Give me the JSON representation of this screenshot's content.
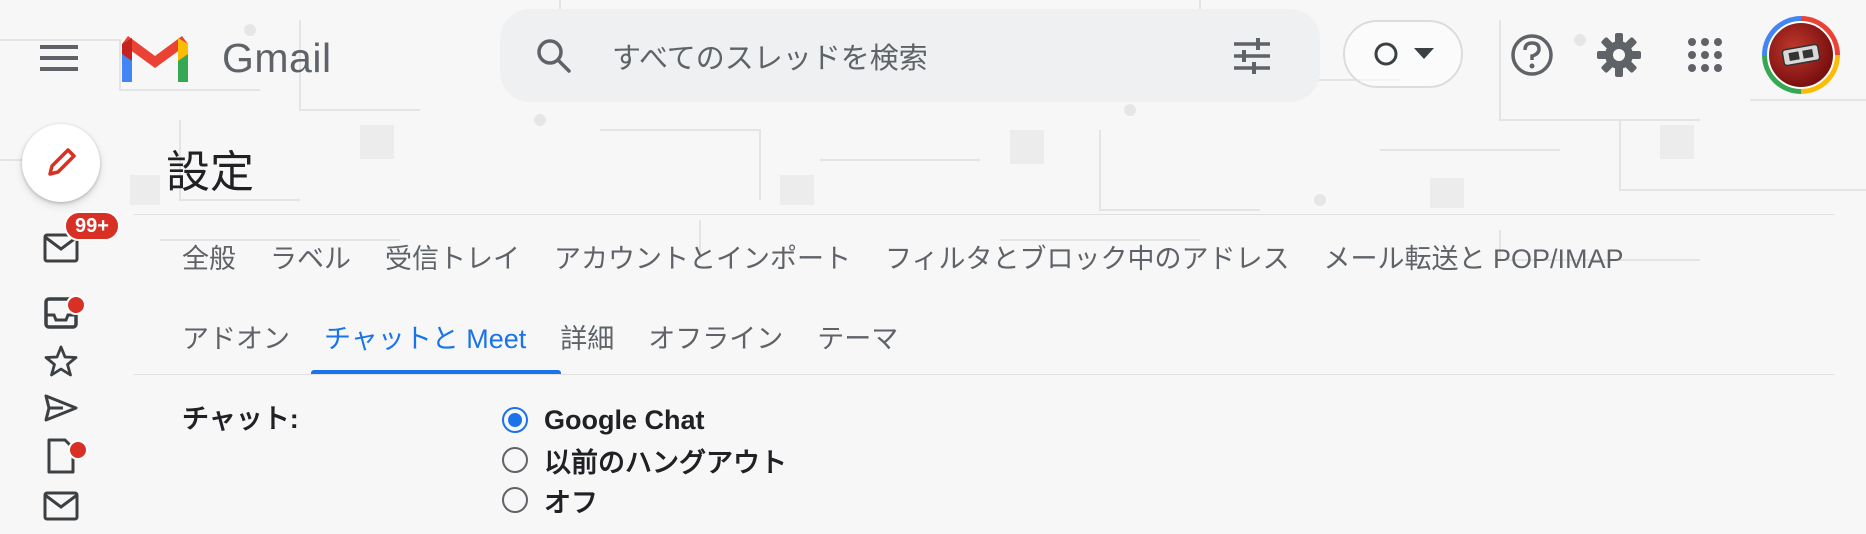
{
  "header": {
    "app_name": "Gmail",
    "search_placeholder": "すべてのスレッドを検索",
    "icons": [
      "menu-icon",
      "search-icon",
      "tune-icon",
      "status-icon",
      "help-icon",
      "gear-icon",
      "apps-icon"
    ]
  },
  "rail": {
    "inbox_badge": "99+",
    "icons": [
      "pencil-icon",
      "mail-icon",
      "chat-icon",
      "star-icon",
      "send-icon",
      "file-icon",
      "mail-icon"
    ]
  },
  "settings": {
    "title": "設定",
    "tabs_row1": [
      "全般",
      "ラベル",
      "受信トレイ",
      "アカウントとインポート",
      "フィルタとブロック中のアドレス",
      "メール転送と POP/IMAP"
    ],
    "tabs_row2": [
      "アドオン",
      "チャットと Meet",
      "詳細",
      "オフライン",
      "テーマ"
    ],
    "active_tab": "チャットと Meet",
    "chat": {
      "label": "チャット:",
      "options": [
        {
          "label": "Google Chat",
          "selected": true
        },
        {
          "label": "以前のハングアウト",
          "selected": false
        },
        {
          "label": "オフ",
          "selected": false
        }
      ]
    }
  },
  "colors": {
    "accent": "#1a73e8",
    "badge": "#d93025"
  }
}
